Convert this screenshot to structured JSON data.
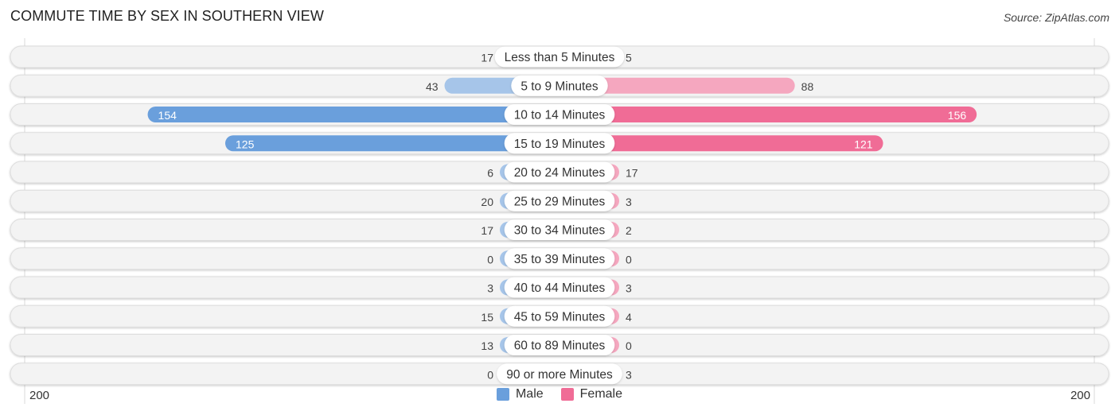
{
  "chart_data": {
    "type": "bar",
    "orientation": "horizontal-diverging",
    "title": "COMMUTE TIME BY SEX IN SOUTHERN VIEW",
    "source": "Source: ZipAtlas.com",
    "categories": [
      "Less than 5 Minutes",
      "5 to 9 Minutes",
      "10 to 14 Minutes",
      "15 to 19 Minutes",
      "20 to 24 Minutes",
      "25 to 29 Minutes",
      "30 to 34 Minutes",
      "35 to 39 Minutes",
      "40 to 44 Minutes",
      "45 to 59 Minutes",
      "60 to 89 Minutes",
      "90 or more Minutes"
    ],
    "series": [
      {
        "name": "Male",
        "color": "#6a9fdc",
        "light_color": "#a6c5e9",
        "values": [
          17,
          43,
          154,
          125,
          6,
          20,
          17,
          0,
          3,
          15,
          13,
          0
        ]
      },
      {
        "name": "Female",
        "color": "#f06c96",
        "light_color": "#f5a7bf",
        "values": [
          5,
          88,
          156,
          121,
          17,
          3,
          2,
          0,
          3,
          4,
          0,
          3
        ]
      }
    ],
    "axis": {
      "left_label": "200",
      "right_label": "200",
      "max": 200
    },
    "legend": {
      "position": "bottom-center",
      "items": [
        "Male",
        "Female"
      ]
    }
  }
}
